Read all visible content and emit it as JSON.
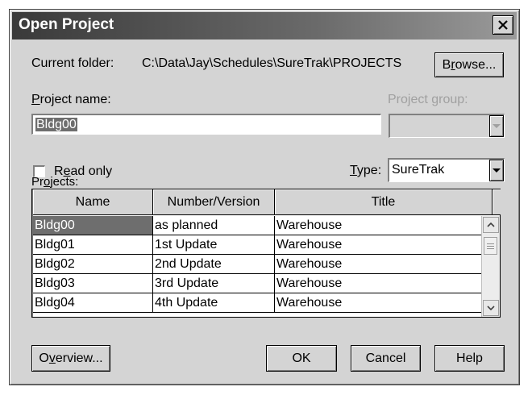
{
  "window": {
    "title": "Open Project"
  },
  "current_folder": {
    "label": "Current folder:",
    "path": "C:\\Data\\Jay\\Schedules\\SureTrak\\PROJECTS"
  },
  "buttons": {
    "browse_pre": "B",
    "browse_u": "r",
    "browse_post": "owse...",
    "overview_pre": "O",
    "overview_u": "v",
    "overview_post": "erview...",
    "ok": "OK",
    "cancel": "Cancel",
    "help": "Help"
  },
  "project_name": {
    "label_u": "P",
    "label_rest": "roject name:",
    "value": "Bldg00"
  },
  "project_group": {
    "label": "Project group:",
    "value": ""
  },
  "read_only": {
    "label_pre": "R",
    "label_u": "e",
    "label_post": "ad only",
    "checked": false
  },
  "type": {
    "label_u": "T",
    "label_rest": "ype:",
    "value": "SureTrak"
  },
  "projects": {
    "label_pre": "Pr",
    "label_u": "o",
    "label_post": "jects:",
    "columns": [
      "Name",
      "Number/Version",
      "Title"
    ],
    "rows": [
      {
        "name": "Bldg00",
        "version": "as planned",
        "title": "Warehouse"
      },
      {
        "name": "Bldg01",
        "version": "1st Update",
        "title": "Warehouse"
      },
      {
        "name": "Bldg02",
        "version": "2nd Update",
        "title": "Warehouse"
      },
      {
        "name": "Bldg03",
        "version": "3rd Update",
        "title": "Warehouse"
      },
      {
        "name": "Bldg04",
        "version": "4th Update",
        "title": "Warehouse"
      }
    ],
    "selected_row": 0
  },
  "icons": {
    "close": "close-icon",
    "dropdown": "chevron-down-icon",
    "scroll_up": "scroll-up-icon",
    "scroll_down": "scroll-down-icon"
  }
}
